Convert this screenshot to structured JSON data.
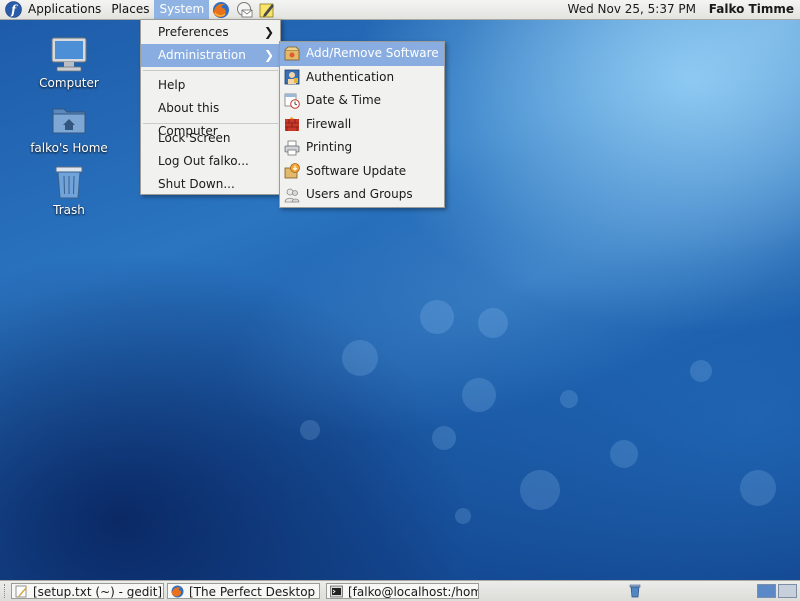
{
  "top_panel": {
    "menus": [
      "Applications",
      "Places",
      "System"
    ],
    "clock": "Wed Nov 25,  5:37 PM",
    "user": "Falko Timme"
  },
  "desktop_icons": [
    {
      "label": "Computer",
      "icon": "computer-icon"
    },
    {
      "label": "falko's Home",
      "icon": "home-folder-icon"
    },
    {
      "label": "Trash",
      "icon": "trash-icon"
    }
  ],
  "system_menu": {
    "items": [
      {
        "label": "Preferences",
        "has_submenu": true
      },
      {
        "label": "Administration",
        "has_submenu": true,
        "highlighted": true
      },
      {
        "label": "Help"
      },
      {
        "label": "About this Computer"
      },
      {
        "label": "Lock Screen"
      },
      {
        "label": "Log Out falko..."
      },
      {
        "label": "Shut Down..."
      }
    ]
  },
  "administration_menu": {
    "items": [
      {
        "label": "Add/Remove Software",
        "icon": "package-icon",
        "highlighted": true
      },
      {
        "label": "Authentication",
        "icon": "authentication-icon"
      },
      {
        "label": "Date & Time",
        "icon": "clock-icon"
      },
      {
        "label": "Firewall",
        "icon": "firewall-icon"
      },
      {
        "label": "Printing",
        "icon": "printer-icon"
      },
      {
        "label": "Software Update",
        "icon": "update-icon"
      },
      {
        "label": "Users and Groups",
        "icon": "users-icon"
      }
    ]
  },
  "taskbar": {
    "tasks": [
      {
        "label": "[setup.txt (~) - gedit]",
        "icon": "text-editor-icon"
      },
      {
        "label": "[The Perfect Desktop -...",
        "icon": "firefox-icon"
      },
      {
        "label": "[falko@localhost:/hom...",
        "icon": "terminal-icon"
      }
    ]
  },
  "colors": {
    "menu_highlight": "#89ade0",
    "panel_bg": "#e8e8e6"
  }
}
